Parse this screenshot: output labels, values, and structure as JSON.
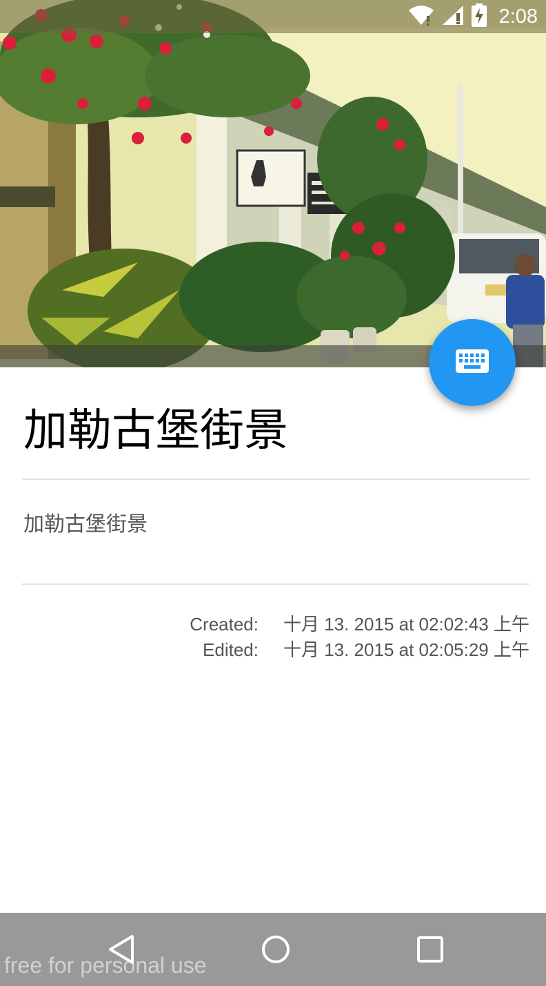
{
  "status_bar": {
    "time": "2:08",
    "icons": [
      "wifi-icon",
      "cell-signal-icon",
      "battery-charging-icon"
    ]
  },
  "header_image": {
    "description_icon": "street-photo"
  },
  "fab": {
    "icon": "keyboard-icon",
    "color": "#2196f3"
  },
  "note": {
    "title": "加勒古堡街景",
    "body": "加勒古堡街景",
    "created_label": "Created:",
    "created_value": "十月 13. 2015 at 02:02:43 上午",
    "edited_label": "Edited:",
    "edited_value": "十月 13. 2015 at 02:05:29 上午"
  },
  "nav_bar": {
    "icons": [
      "back-icon",
      "home-icon",
      "recents-icon"
    ]
  },
  "watermark": "free for personal use"
}
